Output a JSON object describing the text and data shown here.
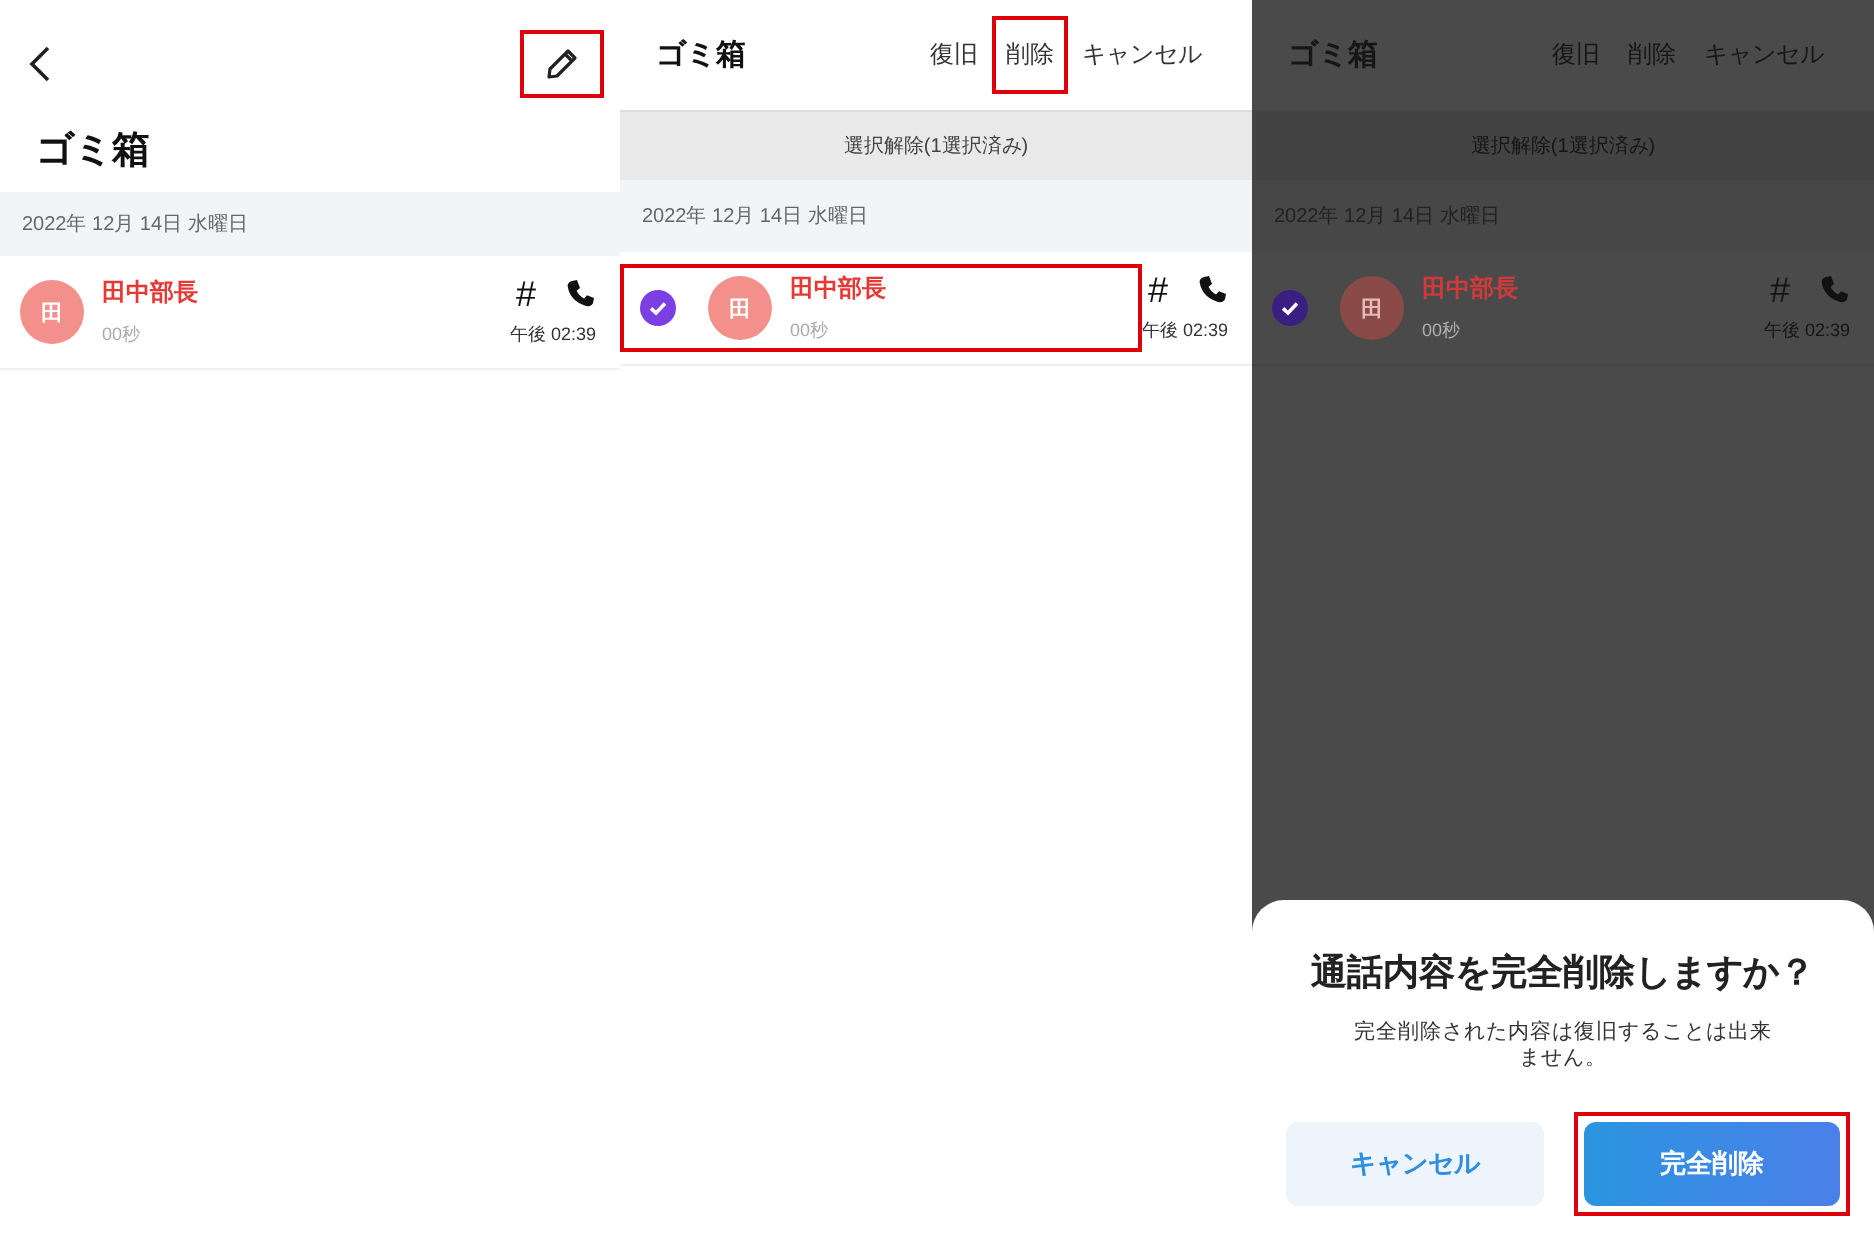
{
  "panels": [
    {
      "kind": "browse",
      "title": "ゴミ箱",
      "edit_highlighted": true,
      "date": "2022年 12月 14日 水曜日",
      "calls": [
        {
          "avatar": "田",
          "name": "田中部長",
          "duration": "00秒",
          "hash": "#",
          "time": "午後 02:39",
          "highlighted": false
        }
      ]
    },
    {
      "kind": "select",
      "title": "ゴミ箱",
      "actions": [
        {
          "label": "復旧",
          "highlighted": false
        },
        {
          "label": "削除",
          "highlighted": true
        },
        {
          "label": "キャンセル",
          "highlighted": false
        }
      ],
      "selection_bar": "選択解除(1選択済み)",
      "date": "2022年 12月 14日 水曜日",
      "calls": [
        {
          "avatar": "田",
          "name": "田中部長",
          "duration": "00秒",
          "hash": "#",
          "time": "午後 02:39",
          "checked": true,
          "highlighted": true
        }
      ]
    },
    {
      "kind": "select",
      "title": "ゴミ箱",
      "actions": [
        {
          "label": "復旧",
          "highlighted": false
        },
        {
          "label": "削除",
          "highlighted": false
        },
        {
          "label": "キャンセル",
          "highlighted": false
        }
      ],
      "selection_bar": "選択解除(1選択済み)",
      "date": "2022年 12月 14日 水曜日",
      "calls": [
        {
          "avatar": "田",
          "name": "田中部長",
          "duration": "00秒",
          "hash": "#",
          "time": "午後 02:39",
          "checked": true,
          "highlighted": false
        }
      ],
      "dialog": {
        "title": "通話内容を完全削除しますか？",
        "message": "完全削除された内容は復旧することは出来ません。",
        "buttons": [
          {
            "label": "キャンセル",
            "kind": "secondary",
            "highlighted": false
          },
          {
            "label": "完全削除",
            "kind": "primary",
            "highlighted": true
          }
        ]
      }
    }
  ]
}
